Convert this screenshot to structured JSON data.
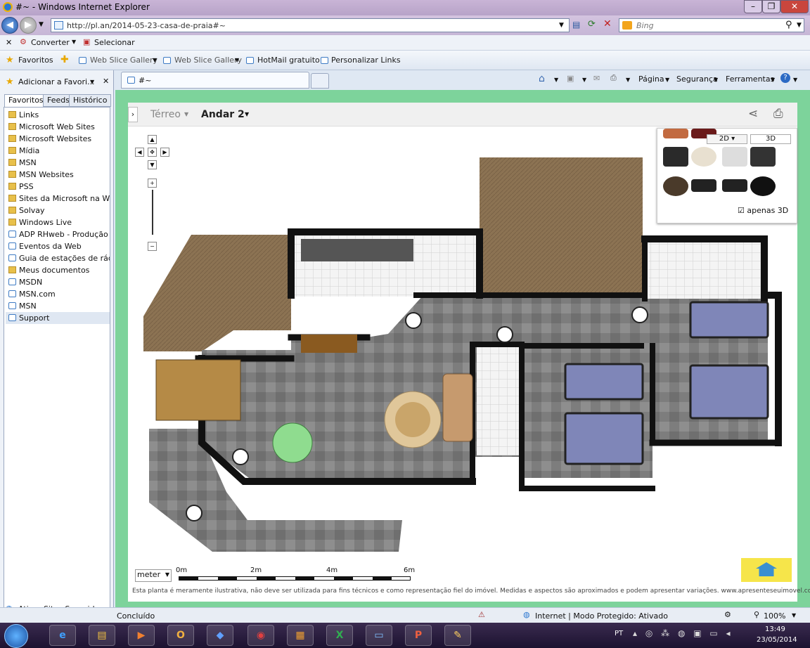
{
  "window": {
    "title": "#~ - Windows Internet Explorer"
  },
  "address": {
    "url": "http://pl.an/2014-05-23-casa-de-praia#~",
    "search_placeholder": "Bing"
  },
  "command_bar": {
    "convert": "Converter",
    "select": "Selecionar"
  },
  "favorites_bar": {
    "favorites": "Favoritos",
    "items": [
      "Web Slice Gallery",
      "Web Slice Gallery",
      "HotMail gratuito",
      "Personalizar Links"
    ]
  },
  "sidebar": {
    "add_label": "Adicionar a Favori...",
    "tabs": [
      "Favoritos",
      "Feeds",
      "Histórico"
    ],
    "items": [
      {
        "label": "Links",
        "icon": "folder-icon"
      },
      {
        "label": "Microsoft Web Sites",
        "icon": "folder-icon"
      },
      {
        "label": "Microsoft Websites",
        "icon": "folder-icon"
      },
      {
        "label": "Mídia",
        "icon": "folder-icon"
      },
      {
        "label": "MSN",
        "icon": "folder-icon"
      },
      {
        "label": "MSN Websites",
        "icon": "folder-icon"
      },
      {
        "label": "PSS",
        "icon": "folder-icon"
      },
      {
        "label": "Sites da Microsoft na Web",
        "icon": "folder-icon"
      },
      {
        "label": "Solvay",
        "icon": "folder-icon"
      },
      {
        "label": "Windows Live",
        "icon": "folder-icon"
      },
      {
        "label": "ADP RHweb - Produção ...",
        "icon": "ie-page-icon"
      },
      {
        "label": "Eventos da Web",
        "icon": "ie-page-icon"
      },
      {
        "label": "Guia de estações de rádio",
        "icon": "ie-page-icon"
      },
      {
        "label": "Meus documentos",
        "icon": "folder-icon"
      },
      {
        "label": "MSDN",
        "icon": "ie-page-icon"
      },
      {
        "label": "MSN.com",
        "icon": "ie-page-icon"
      },
      {
        "label": "MSN",
        "icon": "ie-page-icon"
      },
      {
        "label": "Support",
        "icon": "ie-page-icon"
      }
    ],
    "suggested": "Ativar Sites Sugeridos..."
  },
  "tab": {
    "title": "#~"
  },
  "toolbar_right": {
    "page": "Página",
    "security": "Segurança",
    "tools": "Ferramentas"
  },
  "planner": {
    "floors": [
      "Térreo",
      "Andar 2"
    ],
    "view_2d": "2D",
    "view_3d": "3D",
    "only_3d": "apenas 3D",
    "unit": "meter",
    "scale_labels": [
      "0m",
      "2m",
      "4m",
      "6m"
    ],
    "disclaimer": "Esta planta é meramente ilustrativa, não deve ser utilizada para fins técnicos e como representação fiel do imóvel. Medidas e aspectos são aproximados e podem apresentar variações. www.apresenteseuimovel.com"
  },
  "status": {
    "text": "Concluído",
    "zone": "Internet | Modo Protegido: Ativado",
    "zoom": "100%"
  },
  "taskbar": {
    "lang": "PT",
    "time": "13:49",
    "date": "23/05/2014"
  },
  "colors": {
    "frame_green": "#7dd39b",
    "wall": "#111111",
    "roof": "#8c7353",
    "floor_gray": "#7c7c7c",
    "bed": "#7f86b8"
  }
}
